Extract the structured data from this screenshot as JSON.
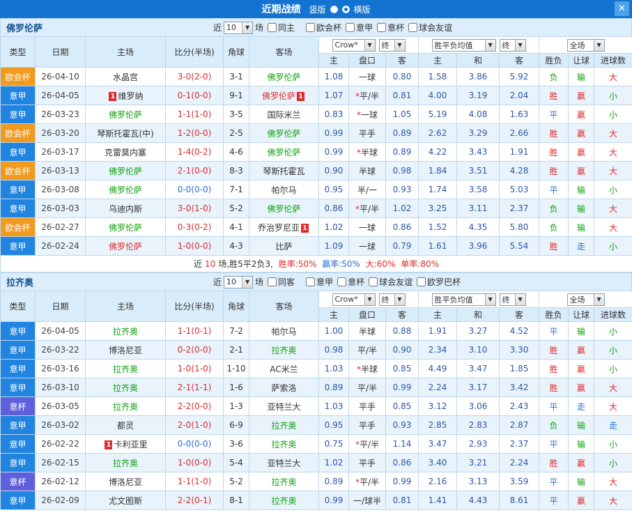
{
  "colors": {
    "red": "#e02a2a",
    "green": "#0fa00f",
    "blue": "#2a6fd4",
    "navy": "#2b57a7",
    "black": "#333333",
    "topbar_bg": "#1373d0",
    "header_bg": "#d9ecfa",
    "alt_row_bg": "#e8f3fc",
    "league": {
      "欧会杯": "#f29a1f",
      "意甲": "#2084e0",
      "意杯": "#5f5fdc"
    },
    "result_map": {
      "胜": "red",
      "平": "blue",
      "负": "green",
      "赢": "red",
      "输": "green",
      "走": "blue",
      "大": "red",
      "小": "green"
    }
  },
  "topbar": {
    "title": "近期战绩",
    "radios": [
      {
        "label": "竖版",
        "checked": false
      },
      {
        "label": "横版",
        "checked": true
      }
    ],
    "close_icon": "✕"
  },
  "controls": {
    "near_label": "近",
    "count_value": "10",
    "games_label": "场",
    "arrow": "▼",
    "selects": {
      "odds": "Crow*",
      "final1": "终",
      "avg": "胜平负均值",
      "final2": "终",
      "scope": "全场"
    }
  },
  "table_header": {
    "cols": [
      "类型",
      "日期",
      "主场",
      "比分(半场)",
      "角球",
      "客场"
    ],
    "odds_cols": [
      "主",
      "盘口",
      "客"
    ],
    "avg_cols": [
      "主",
      "和",
      "客"
    ],
    "result_cols": [
      "胜负",
      "让球",
      "进球数"
    ]
  },
  "red_card_label": "1",
  "sections": [
    {
      "team": "佛罗伦萨",
      "filters": [
        "同主",
        "欧会杯",
        "意甲",
        "意杯",
        "球会友谊"
      ],
      "rows": [
        {
          "type": "欧会杯",
          "date": "26-04-10",
          "home": "水晶宫",
          "home_color": "black",
          "score": "3-0(2-0)",
          "score_color": "red",
          "corner": "3-1",
          "away": "佛罗伦萨",
          "away_color": "green",
          "o1": "1.08",
          "hcap": "一球",
          "o2": "0.80",
          "a1": "1.58",
          "a2": "3.86",
          "a3": "5.92",
          "res": "负",
          "hres": "输",
          "goals": "大"
        },
        {
          "type": "意甲",
          "date": "26-04-05",
          "home": "维罗纳",
          "home_color": "black",
          "home_rc": "left",
          "score": "0-1(0-0)",
          "score_color": "red",
          "corner": "9-1",
          "away": "佛罗伦萨",
          "away_color": "red",
          "away_rc": "right",
          "o1": "1.07",
          "hcap": "*平/半",
          "o2": "0.81",
          "a1": "4.00",
          "a2": "3.19",
          "a3": "2.04",
          "res": "胜",
          "hres": "赢",
          "goals": "小"
        },
        {
          "type": "意甲",
          "date": "26-03-23",
          "home": "佛罗伦萨",
          "home_color": "green",
          "score": "1-1(1-0)",
          "score_color": "red",
          "corner": "3-5",
          "away": "国际米兰",
          "away_color": "black",
          "o1": "0.83",
          "hcap": "*一球",
          "o2": "1.05",
          "a1": "5.19",
          "a2": "4.08",
          "a3": "1.63",
          "res": "平",
          "hres": "赢",
          "goals": "小"
        },
        {
          "type": "欧会杯",
          "date": "26-03-20",
          "home": "琴斯托霍瓦(中)",
          "home_color": "black",
          "score": "1-2(0-0)",
          "score_color": "red",
          "corner": "2-5",
          "away": "佛罗伦萨",
          "away_color": "green",
          "o1": "0.99",
          "hcap": "平手",
          "o2": "0.89",
          "a1": "2.62",
          "a2": "3.29",
          "a3": "2.66",
          "res": "胜",
          "hres": "赢",
          "goals": "大"
        },
        {
          "type": "意甲",
          "date": "26-03-17",
          "home": "克雷莫内塞",
          "home_color": "black",
          "score": "1-4(0-2)",
          "score_color": "red",
          "corner": "4-6",
          "away": "佛罗伦萨",
          "away_color": "green",
          "o1": "0.99",
          "hcap": "*半球",
          "o2": "0.89",
          "a1": "4.22",
          "a2": "3.43",
          "a3": "1.91",
          "res": "胜",
          "hres": "赢",
          "goals": "大"
        },
        {
          "type": "欧会杯",
          "date": "26-03-13",
          "home": "佛罗伦萨",
          "home_color": "green",
          "score": "2-1(0-0)",
          "score_color": "red",
          "corner": "8-3",
          "away": "琴斯托霍瓦",
          "away_color": "black",
          "o1": "0.90",
          "hcap": "半球",
          "o2": "0.98",
          "a1": "1.84",
          "a2": "3.51",
          "a3": "4.28",
          "res": "胜",
          "hres": "赢",
          "goals": "大"
        },
        {
          "type": "意甲",
          "date": "26-03-08",
          "home": "佛罗伦萨",
          "home_color": "green",
          "score": "0-0(0-0)",
          "score_color": "blue",
          "corner": "7-1",
          "away": "帕尔马",
          "away_color": "black",
          "o1": "0.95",
          "hcap": "半/一",
          "o2": "0.93",
          "a1": "1.74",
          "a2": "3.58",
          "a3": "5.03",
          "res": "平",
          "hres": "输",
          "goals": "小"
        },
        {
          "type": "意甲",
          "date": "26-03-03",
          "home": "乌迪内斯",
          "home_color": "black",
          "score": "3-0(1-0)",
          "score_color": "red",
          "corner": "5-2",
          "away": "佛罗伦萨",
          "away_color": "green",
          "o1": "0.86",
          "hcap": "*平/半",
          "o2": "1.02",
          "a1": "3.25",
          "a2": "3.11",
          "a3": "2.37",
          "res": "负",
          "hres": "输",
          "goals": "大"
        },
        {
          "type": "欧会杯",
          "date": "26-02-27",
          "home": "佛罗伦萨",
          "home_color": "green",
          "score": "0-3(0-2)",
          "score_color": "red",
          "corner": "4-1",
          "away": "乔治罗尼亚",
          "away_color": "black",
          "away_rc": "right",
          "o1": "1.02",
          "hcap": "一球",
          "o2": "0.86",
          "a1": "1.52",
          "a2": "4.35",
          "a3": "5.80",
          "res": "负",
          "hres": "输",
          "goals": "大"
        },
        {
          "type": "意甲",
          "date": "26-02-24",
          "home": "佛罗伦萨",
          "home_color": "red",
          "score": "1-0(0-0)",
          "score_color": "red",
          "corner": "4-3",
          "away": "比萨",
          "away_color": "black",
          "o1": "1.09",
          "hcap": "一球",
          "o2": "0.79",
          "a1": "1.61",
          "a2": "3.96",
          "a3": "5.54",
          "res": "胜",
          "hres": "走",
          "goals": "小"
        }
      ],
      "summary": [
        {
          "text": "近",
          "color": "black"
        },
        {
          "text": "10",
          "color": "red"
        },
        {
          "text": "场,胜5平2负3,",
          "color": "black"
        },
        {
          "text": " 胜率:50%",
          "color": "red"
        },
        {
          "text": " 赢率:50%",
          "color": "blue"
        },
        {
          "text": " 大:60%",
          "color": "red"
        },
        {
          "text": " 单率:80%",
          "color": "red"
        }
      ]
    },
    {
      "team": "拉齐奥",
      "filters": [
        "同客",
        "意甲",
        "意杯",
        "球会友谊",
        "欧罗巴杯"
      ],
      "rows": [
        {
          "type": "意甲",
          "date": "26-04-05",
          "home": "拉齐奥",
          "home_color": "green",
          "score": "1-1(0-1)",
          "score_color": "red",
          "corner": "7-2",
          "away": "帕尔马",
          "away_color": "black",
          "o1": "1.00",
          "hcap": "半球",
          "o2": "0.88",
          "a1": "1.91",
          "a2": "3.27",
          "a3": "4.52",
          "res": "平",
          "hres": "输",
          "goals": "小"
        },
        {
          "type": "意甲",
          "date": "26-03-22",
          "home": "博洛尼亚",
          "home_color": "black",
          "score": "0-2(0-0)",
          "score_color": "red",
          "corner": "2-1",
          "away": "拉齐奥",
          "away_color": "green",
          "o1": "0.98",
          "hcap": "平/半",
          "o2": "0.90",
          "a1": "2.34",
          "a2": "3.10",
          "a3": "3.30",
          "res": "胜",
          "hres": "赢",
          "goals": "小"
        },
        {
          "type": "意甲",
          "date": "26-03-16",
          "home": "拉齐奥",
          "home_color": "green",
          "score": "1-0(1-0)",
          "score_color": "red",
          "corner": "1-10",
          "away": "AC米兰",
          "away_color": "black",
          "o1": "1.03",
          "hcap": "*半球",
          "o2": "0.85",
          "a1": "4.49",
          "a2": "3.47",
          "a3": "1.85",
          "res": "胜",
          "hres": "赢",
          "goals": "小"
        },
        {
          "type": "意甲",
          "date": "26-03-10",
          "home": "拉齐奥",
          "home_color": "green",
          "score": "2-1(1-1)",
          "score_color": "red",
          "corner": "1-6",
          "away": "萨索洛",
          "away_color": "black",
          "o1": "0.89",
          "hcap": "平/半",
          "o2": "0.99",
          "a1": "2.24",
          "a2": "3.17",
          "a3": "3.42",
          "res": "胜",
          "hres": "赢",
          "goals": "大"
        },
        {
          "type": "意杯",
          "date": "26-03-05",
          "home": "拉齐奥",
          "home_color": "green",
          "score": "2-2(0-0)",
          "score_color": "red",
          "corner": "1-3",
          "away": "亚特兰大",
          "away_color": "black",
          "o1": "1.03",
          "hcap": "平手",
          "o2": "0.85",
          "a1": "3.12",
          "a2": "3.06",
          "a3": "2.43",
          "res": "平",
          "hres": "走",
          "goals": "大"
        },
        {
          "type": "意甲",
          "date": "26-03-02",
          "home": "都灵",
          "home_color": "black",
          "score": "2-0(1-0)",
          "score_color": "red",
          "corner": "6-9",
          "away": "拉齐奥",
          "away_color": "green",
          "o1": "0.95",
          "hcap": "平手",
          "o2": "0.93",
          "a1": "2.85",
          "a2": "2.83",
          "a3": "2.87",
          "res": "负",
          "hres": "输",
          "goals": "走"
        },
        {
          "type": "意甲",
          "date": "26-02-22",
          "home": "卡利亚里",
          "home_color": "black",
          "home_rc": "left",
          "score": "0-0(0-0)",
          "score_color": "blue",
          "corner": "3-6",
          "away": "拉齐奥",
          "away_color": "green",
          "o1": "0.75",
          "hcap": "*平/半",
          "o2": "1.14",
          "a1": "3.47",
          "a2": "2.93",
          "a3": "2.37",
          "res": "平",
          "hres": "输",
          "goals": "小"
        },
        {
          "type": "意甲",
          "date": "26-02-15",
          "home": "拉齐奥",
          "home_color": "green",
          "score": "1-0(0-0)",
          "score_color": "red",
          "corner": "5-4",
          "away": "亚特兰大",
          "away_color": "black",
          "o1": "1.02",
          "hcap": "平手",
          "o2": "0.86",
          "a1": "3.40",
          "a2": "3.21",
          "a3": "2.24",
          "res": "胜",
          "hres": "赢",
          "goals": "小"
        },
        {
          "type": "意杯",
          "date": "26-02-12",
          "home": "博洛尼亚",
          "home_color": "black",
          "score": "1-1(1-0)",
          "score_color": "red",
          "corner": "5-2",
          "away": "拉齐奥",
          "away_color": "green",
          "o1": "0.89",
          "hcap": "*平/半",
          "o2": "0.99",
          "a1": "2.16",
          "a2": "3.13",
          "a3": "3.59",
          "res": "平",
          "hres": "输",
          "goals": "大"
        },
        {
          "type": "意甲",
          "date": "26-02-09",
          "home": "尤文图斯",
          "home_color": "black",
          "score": "2-2(0-1)",
          "score_color": "red",
          "corner": "8-1",
          "away": "拉齐奥",
          "away_color": "green",
          "o1": "0.99",
          "hcap": "一/球半",
          "o2": "0.81",
          "a1": "1.41",
          "a2": "4.43",
          "a3": "8.61",
          "res": "平",
          "hres": "赢",
          "goals": "大"
        }
      ]
    }
  ]
}
